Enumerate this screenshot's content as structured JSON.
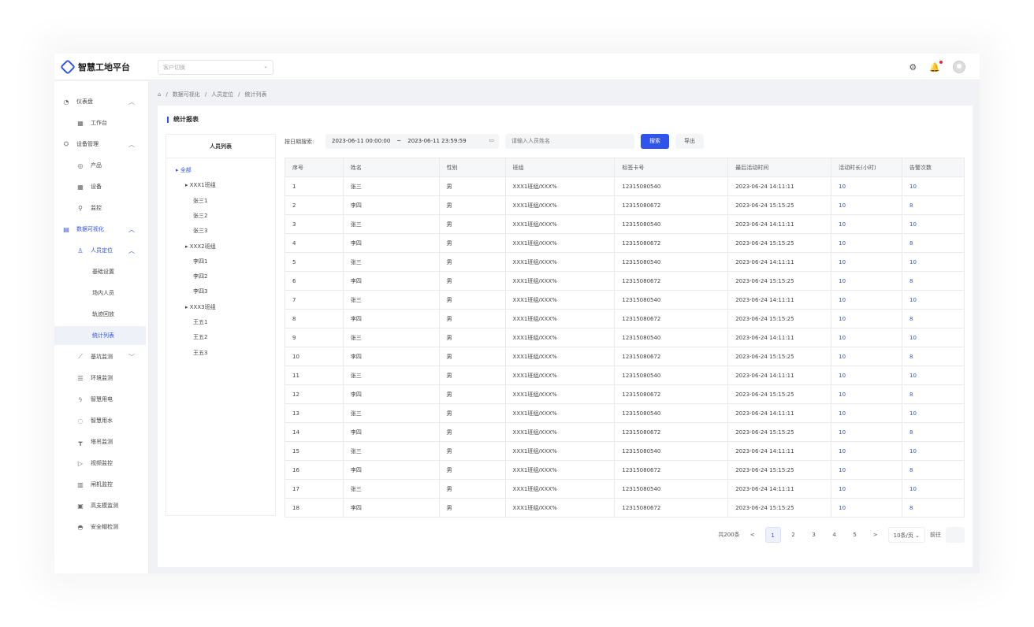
{
  "app": {
    "title": "智慧工地平台",
    "customer_placeholder": "客户切换"
  },
  "sidebar": {
    "items": [
      {
        "label": "仪表盘",
        "icon": "dashboard-icon",
        "arrow": "^"
      },
      {
        "label": "工作台",
        "icon": "grid-icon"
      },
      {
        "label": "设备管理",
        "icon": "device-icon",
        "arrow": "^"
      },
      {
        "label": "产品",
        "icon": "product-icon"
      },
      {
        "label": "设备",
        "icon": "grid-icon"
      },
      {
        "label": "监控",
        "icon": "location-icon"
      },
      {
        "label": "数据可视化",
        "icon": "chart-icon",
        "arrow": "^"
      },
      {
        "label": "人员定位",
        "icon": "person-icon",
        "arrow": "^"
      },
      {
        "label": "基础设置"
      },
      {
        "label": "场内人员"
      },
      {
        "label": "轨迹回放"
      },
      {
        "label": "统计列表"
      },
      {
        "label": "基坑监测",
        "icon": "trend-icon",
        "arrow": "v"
      },
      {
        "label": "环境监测",
        "icon": "env-icon"
      },
      {
        "label": "智慧用电",
        "icon": "power-icon"
      },
      {
        "label": "智慧用水",
        "icon": "water-icon"
      },
      {
        "label": "塔吊监测",
        "icon": "crane-icon"
      },
      {
        "label": "视频监控",
        "icon": "video-icon"
      },
      {
        "label": "闸机监控",
        "icon": "gate-icon"
      },
      {
        "label": "高支模监测",
        "icon": "formwork-icon"
      },
      {
        "label": "安全帽检测",
        "icon": "helmet-icon"
      }
    ]
  },
  "breadcrumb": {
    "home_icon": "home-icon",
    "items": [
      "数据可视化",
      "人员定位",
      "统计列表"
    ]
  },
  "panel": {
    "title": "统计报表"
  },
  "tree": {
    "title": "人员列表",
    "nodes": [
      {
        "label": "全部",
        "level": 0,
        "selected": true
      },
      {
        "label": "XXX1班组",
        "level": 1
      },
      {
        "label": "张三1",
        "level": 2
      },
      {
        "label": "张三2",
        "level": 2
      },
      {
        "label": "张三3",
        "level": 2
      },
      {
        "label": "XXX2班组",
        "level": 1
      },
      {
        "label": "李四1",
        "level": 2
      },
      {
        "label": "李四2",
        "level": 2
      },
      {
        "label": "李四3",
        "level": 2
      },
      {
        "label": "XXX3班组",
        "level": 1
      },
      {
        "label": "王五1",
        "level": 2
      },
      {
        "label": "王五2",
        "level": 2
      },
      {
        "label": "王五3",
        "level": 2
      }
    ]
  },
  "filters": {
    "date_label": "按日期搜索:",
    "start": "2023-06-11 00:00:00",
    "sep": "~",
    "end": "2023-06-11 23:59:59",
    "name_placeholder": "请输入人员姓名",
    "search_label": "搜索",
    "export_label": "导出"
  },
  "table": {
    "columns": [
      "序号",
      "姓名",
      "性别",
      "班组",
      "标签卡号",
      "最后活动时间",
      "活动时长(小时)",
      "告警次数"
    ],
    "rows": [
      [
        "1",
        "张三",
        "男",
        "XXX1班组/XXX%",
        "12315080540",
        "2023-06-24 14:11:11",
        "10",
        "10"
      ],
      [
        "2",
        "李四",
        "男",
        "XXX1班组/XXX%",
        "12315080672",
        "2023-06-24 15:15:25",
        "10",
        "8"
      ],
      [
        "3",
        "张三",
        "男",
        "XXX1班组/XXX%",
        "12315080540",
        "2023-06-24 14:11:11",
        "10",
        "10"
      ],
      [
        "4",
        "李四",
        "男",
        "XXX1班组/XXX%",
        "12315080672",
        "2023-06-24 15:15:25",
        "10",
        "8"
      ],
      [
        "5",
        "张三",
        "男",
        "XXX1班组/XXX%",
        "12315080540",
        "2023-06-24 14:11:11",
        "10",
        "10"
      ],
      [
        "6",
        "李四",
        "男",
        "XXX1班组/XXX%",
        "12315080672",
        "2023-06-24 15:15:25",
        "10",
        "8"
      ],
      [
        "7",
        "张三",
        "男",
        "XXX1班组/XXX%",
        "12315080540",
        "2023-06-24 14:11:11",
        "10",
        "10"
      ],
      [
        "8",
        "李四",
        "男",
        "XXX1班组/XXX%",
        "12315080672",
        "2023-06-24 15:15:25",
        "10",
        "8"
      ],
      [
        "9",
        "张三",
        "男",
        "XXX1班组/XXX%",
        "12315080540",
        "2023-06-24 14:11:11",
        "10",
        "10"
      ],
      [
        "10",
        "李四",
        "男",
        "XXX1班组/XXX%",
        "12315080672",
        "2023-06-24 15:15:25",
        "10",
        "8"
      ],
      [
        "11",
        "张三",
        "男",
        "XXX1班组/XXX%",
        "12315080540",
        "2023-06-24 14:11:11",
        "10",
        "10"
      ],
      [
        "12",
        "李四",
        "男",
        "XXX1班组/XXX%",
        "12315080672",
        "2023-06-24 15:15:25",
        "10",
        "8"
      ],
      [
        "13",
        "张三",
        "男",
        "XXX1班组/XXX%",
        "12315080540",
        "2023-06-24 14:11:11",
        "10",
        "10"
      ],
      [
        "14",
        "李四",
        "男",
        "XXX1班组/XXX%",
        "12315080672",
        "2023-06-24 15:15:25",
        "10",
        "8"
      ],
      [
        "15",
        "张三",
        "男",
        "XXX1班组/XXX%",
        "12315080540",
        "2023-06-24 14:11:11",
        "10",
        "10"
      ],
      [
        "16",
        "李四",
        "男",
        "XXX1班组/XXX%",
        "12315080672",
        "2023-06-24 15:15:25",
        "10",
        "8"
      ],
      [
        "17",
        "张三",
        "男",
        "XXX1班组/XXX%",
        "12315080540",
        "2023-06-24 14:11:11",
        "10",
        "10"
      ],
      [
        "18",
        "李四",
        "男",
        "XXX1班组/XXX%",
        "12315080672",
        "2023-06-24 15:15:25",
        "10",
        "8"
      ]
    ]
  },
  "pager": {
    "total": "共200条",
    "prev": "<",
    "next": ">",
    "pages": [
      "1",
      "2",
      "3",
      "4",
      "5"
    ],
    "current": "1",
    "size": "10条/页",
    "jump_label": "前往"
  },
  "colors": {
    "accent": "#2f54eb"
  }
}
